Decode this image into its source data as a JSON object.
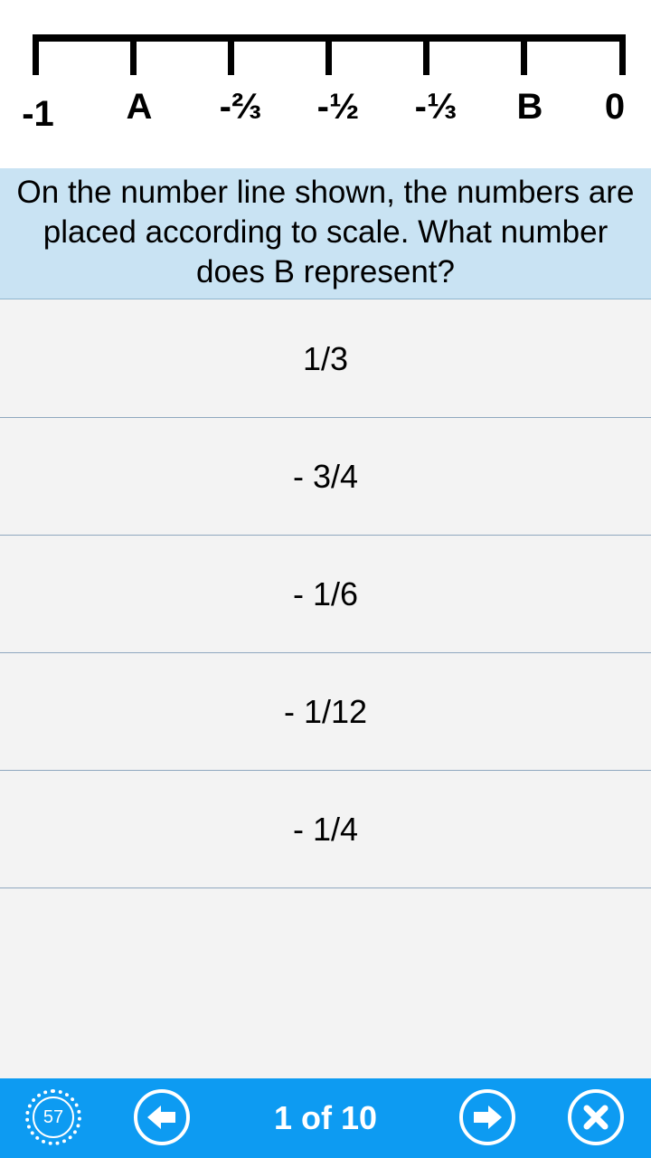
{
  "figure": {
    "tick_labels": [
      "-1",
      "A",
      "-⅔",
      "-½",
      "-⅓",
      "B",
      "0"
    ]
  },
  "question": {
    "text": "On the number line shown, the numbers are placed according to scale. What number does B represent?"
  },
  "answers": [
    "1/3",
    "- 3/4",
    "- 1/6",
    "- 1/12",
    "- 1/4"
  ],
  "bottom_bar": {
    "timer_value": "57",
    "page_indicator": "1 of 10",
    "timer_icon": "timer-icon",
    "prev_icon": "arrow-left-icon",
    "next_icon": "arrow-right-icon",
    "close_icon": "close-icon"
  },
  "colors": {
    "question_bg": "#c9e3f3",
    "bottom_bar_bg": "#0d9bf2",
    "divider": "#8fa8bf"
  }
}
